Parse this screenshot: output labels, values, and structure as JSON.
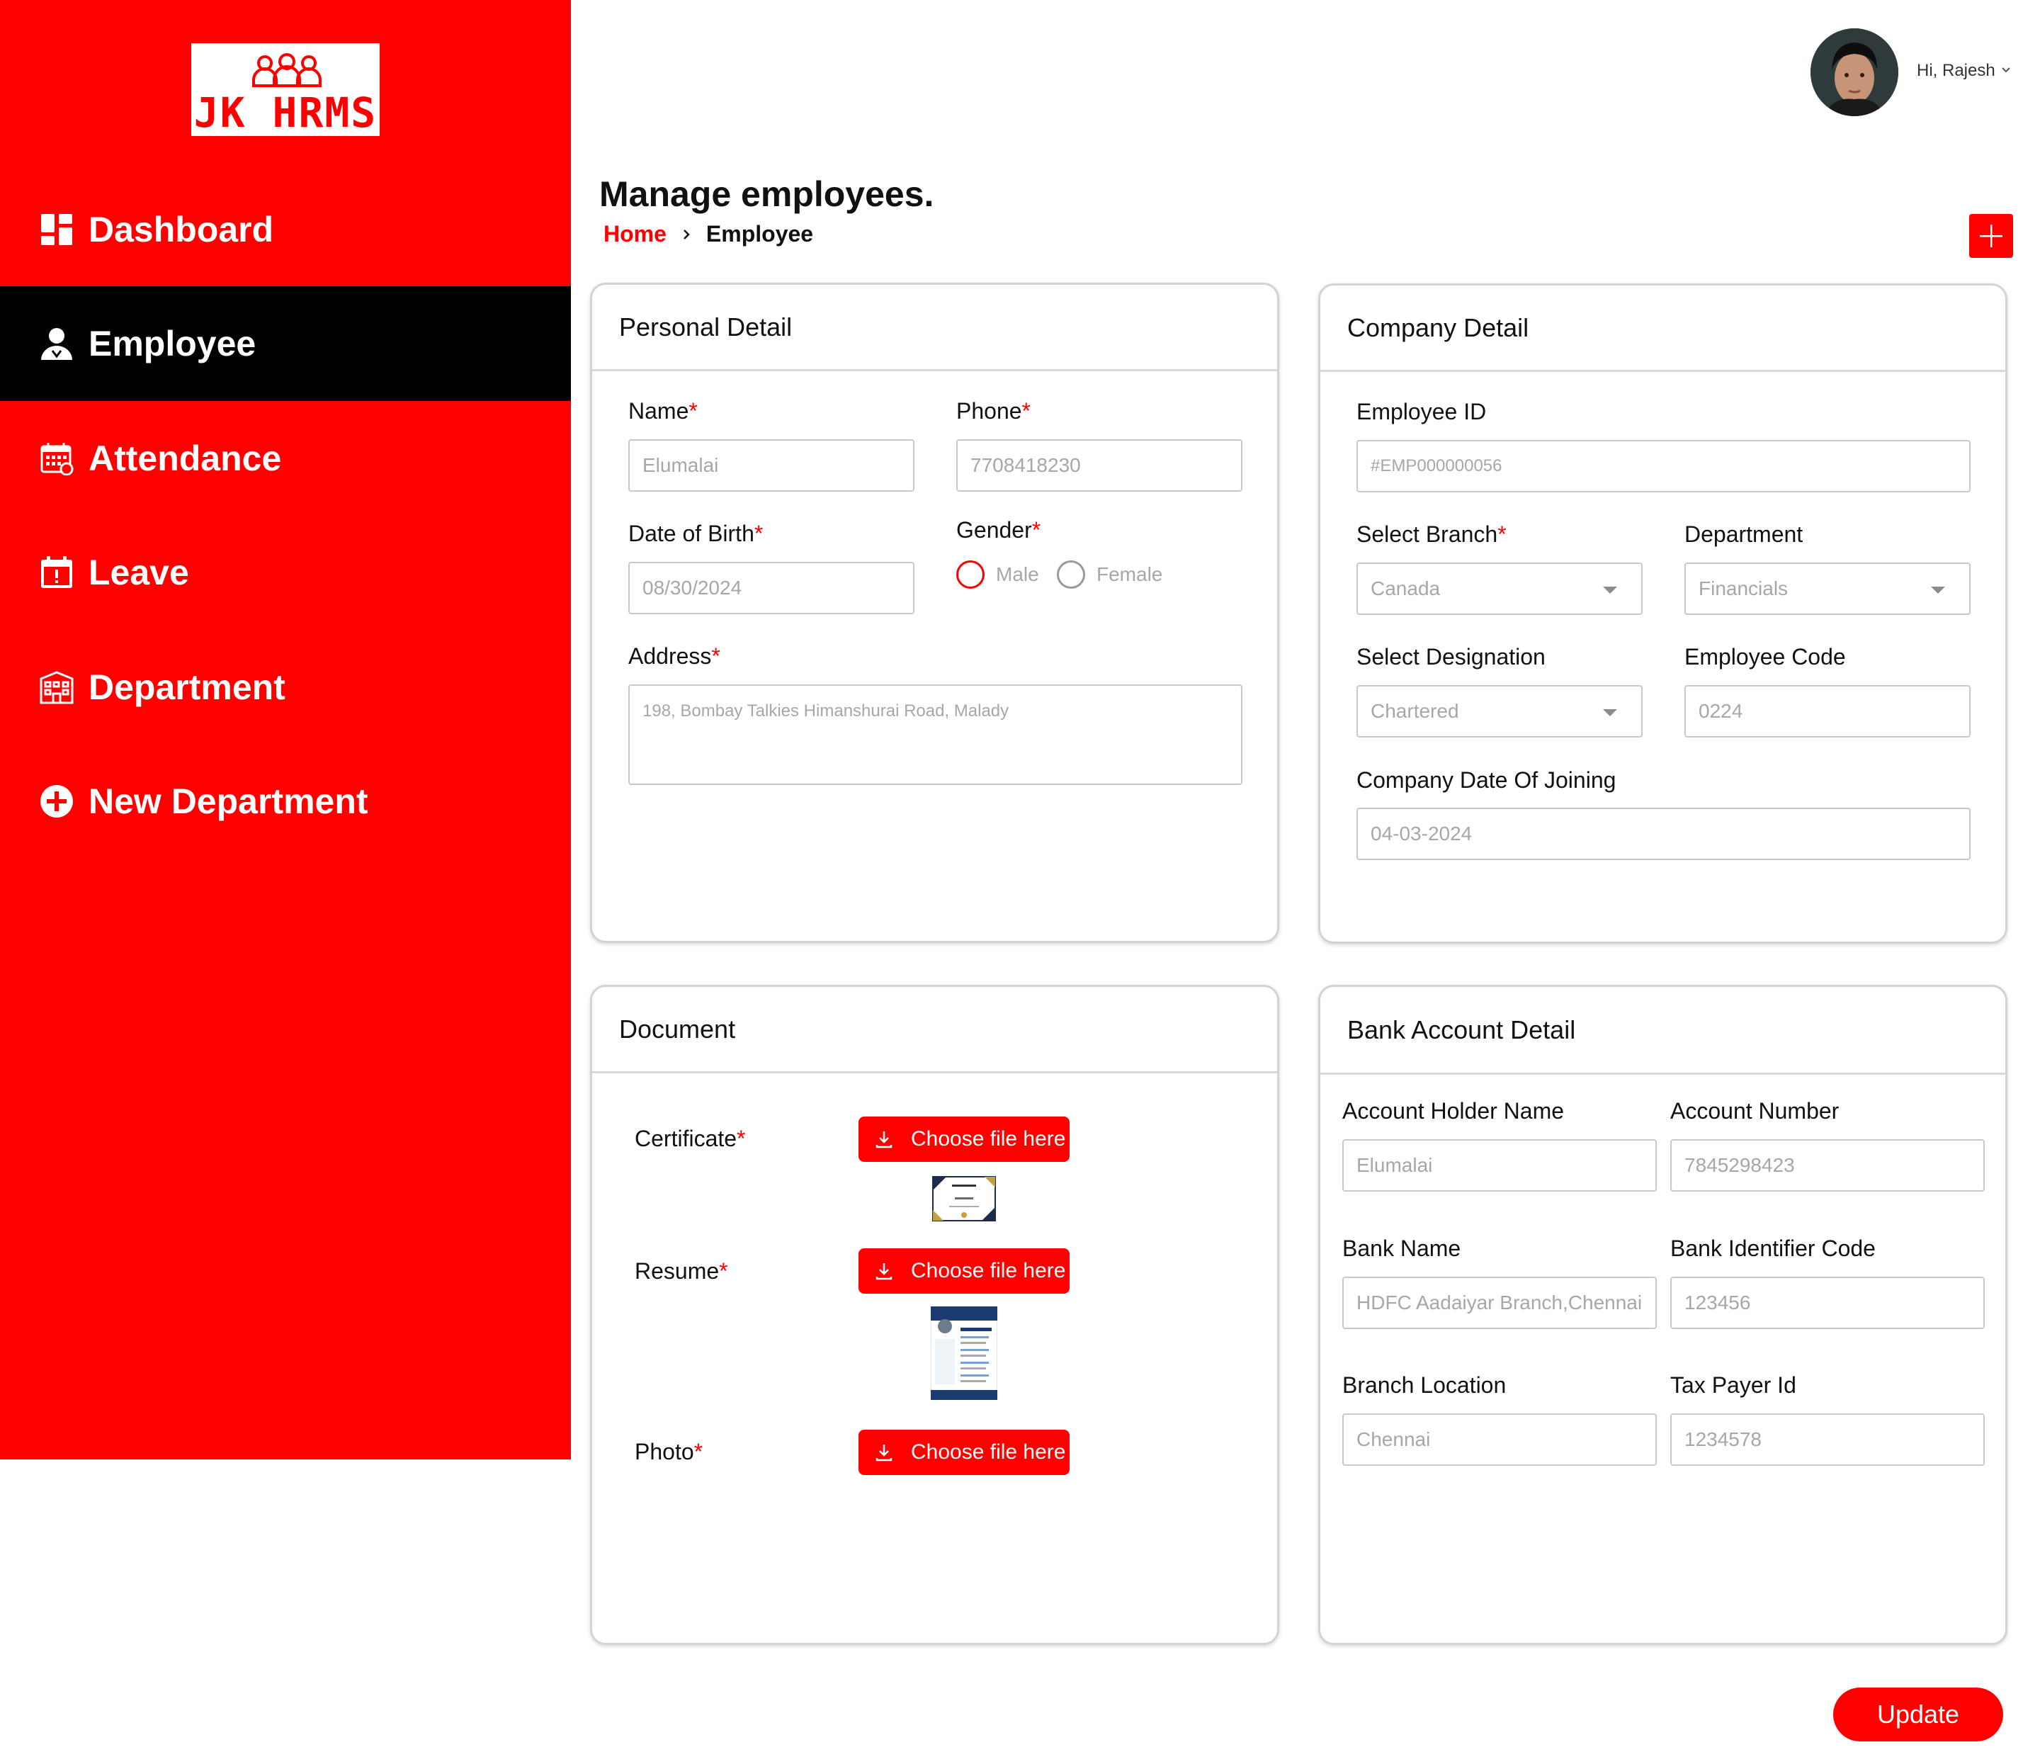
{
  "app": {
    "logo_text": "JK HRMS"
  },
  "sidebar": {
    "items": [
      {
        "label": "Dashboard",
        "icon": "dashboard-icon"
      },
      {
        "label": "Employee",
        "icon": "user-icon",
        "active": true
      },
      {
        "label": "Attendance",
        "icon": "calendar-icon"
      },
      {
        "label": "Leave",
        "icon": "calendar-alert-icon"
      },
      {
        "label": "Department",
        "icon": "building-icon"
      },
      {
        "label": "New Department",
        "icon": "plus-circle-icon"
      }
    ]
  },
  "header": {
    "greeting": "Hi, Rajesh"
  },
  "page": {
    "title": "Manage employees.",
    "breadcrumb": {
      "home": "Home",
      "current": "Employee"
    }
  },
  "personal": {
    "title": "Personal Detail",
    "name_label": "Name",
    "name_value": "Elumalai",
    "phone_label": "Phone",
    "phone_value": "7708418230",
    "dob_label": "Date of Birth",
    "dob_value": "08/30/2024",
    "gender_label": "Gender",
    "gender_options": [
      "Male",
      "Female"
    ],
    "address_label": "Address",
    "address_value": "198, Bombay Talkies Himanshurai Road, Malady"
  },
  "company": {
    "title": "Company Detail",
    "employee_id_label": "Employee ID",
    "employee_id_value": "#EMP000000056",
    "branch_label": "Select Branch",
    "branch_value": "Canada",
    "department_label": "Department",
    "department_value": "Financials",
    "designation_label": "Select Designation",
    "designation_value": "Chartered",
    "emp_code_label": "Employee Code",
    "emp_code_value": "0224",
    "doj_label": "Company Date Of Joining",
    "doj_value": "04-03-2024"
  },
  "document": {
    "title": "Document",
    "certificate_label": "Certificate",
    "resume_label": "Resume",
    "photo_label": "Photo",
    "choose_file": "Choose file here"
  },
  "bank": {
    "title": "Bank Account Detail",
    "holder_label": "Account Holder Name",
    "holder_value": "Elumalai",
    "acc_num_label": "Account Number",
    "acc_num_value": "7845298423",
    "bank_name_label": "Bank Name",
    "bank_name_value": "HDFC Aadaiyar Branch,Chennai",
    "bic_label": "Bank Identifier Code",
    "bic_value": "123456",
    "location_label": "Branch Location",
    "location_value": "Chennai",
    "tax_label": "Tax Payer Id",
    "tax_value": "1234578"
  },
  "actions": {
    "update": "Update"
  },
  "colors": {
    "accent": "#ff0000",
    "sidebar_active": "#000000"
  }
}
